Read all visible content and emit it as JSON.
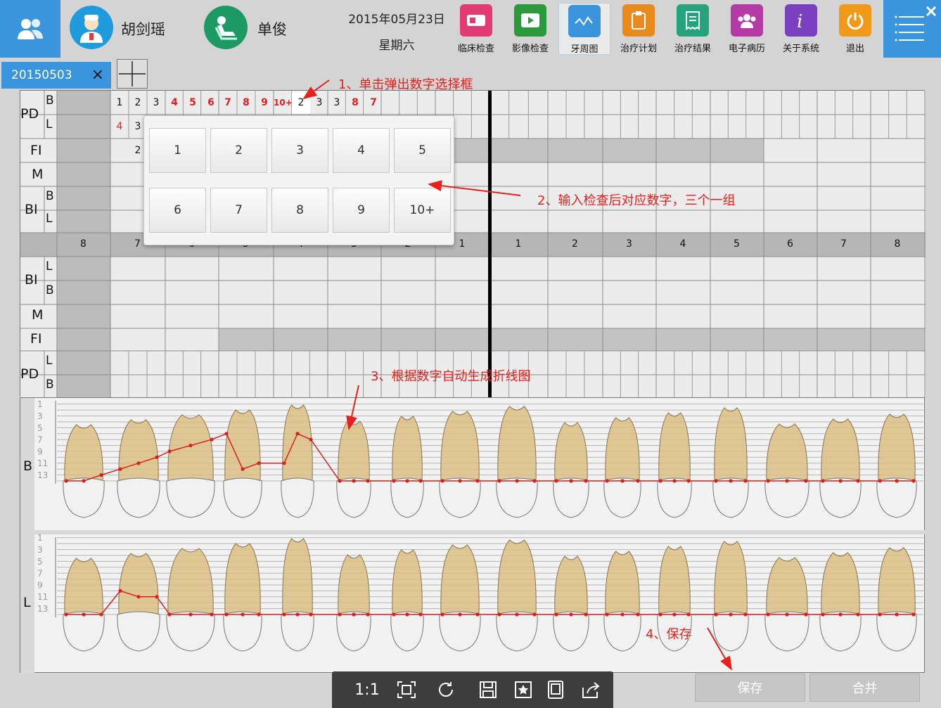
{
  "topbar": {
    "doctor_name": "胡剑瑶",
    "patient_name": "单俊",
    "date": "2015年05月23日",
    "weekday": "星期六",
    "buttons": [
      {
        "label": "临床检查",
        "color": "#e23a73",
        "icon": "id-card-icon"
      },
      {
        "label": "影像检查",
        "color": "#2a9a3c",
        "icon": "video-icon"
      },
      {
        "label": "牙周图",
        "color": "#3b95dc",
        "icon": "pulse-chart-icon"
      },
      {
        "label": "治疗计划",
        "color": "#e98a1f",
        "icon": "clipboard-icon"
      },
      {
        "label": "治疗结果",
        "color": "#26a37c",
        "icon": "receipt-icon"
      },
      {
        "label": "电子病历",
        "color": "#b43aa6",
        "icon": "group-icon"
      },
      {
        "label": "关于系统",
        "color": "#7a3ec0",
        "icon": "info-icon"
      },
      {
        "label": "退出",
        "color": "#f19a1a",
        "icon": "power-icon"
      }
    ]
  },
  "tab": {
    "label": "20150503",
    "close": "×"
  },
  "chart": {
    "row_labels_top": {
      "pd": "PD",
      "b": "B",
      "l": "L",
      "fi": "FI",
      "m": "M",
      "bi": "BI"
    },
    "row_labels_bottom": {
      "bi": "BI",
      "l": "L",
      "b": "B",
      "m": "M",
      "fi": "FI",
      "pd": "PD"
    },
    "pd_b_values": [
      "1",
      "2",
      "3",
      "4",
      "5",
      "6",
      "7",
      "8",
      "9",
      "10+",
      "2",
      "3",
      "3",
      "8",
      "7"
    ],
    "pd_b_red": [
      false,
      false,
      false,
      true,
      true,
      true,
      true,
      true,
      true,
      true,
      false,
      false,
      false,
      true,
      true
    ],
    "pd_l_values": [
      "4",
      "3"
    ],
    "fi_value": "2",
    "left_teeth": [
      "8",
      "7",
      "6",
      "5",
      "4",
      "3",
      "2",
      "1"
    ],
    "right_teeth": [
      "1",
      "2",
      "3",
      "4",
      "5",
      "6",
      "7",
      "8"
    ]
  },
  "popup": {
    "keys": [
      "1",
      "2",
      "3",
      "4",
      "5",
      "6",
      "7",
      "8",
      "9",
      "10+"
    ]
  },
  "graph": {
    "b_label": "B",
    "l_label": "L",
    "scale": [
      "13",
      "11",
      "9",
      "7",
      "5",
      "3",
      "1"
    ],
    "b_line": [
      0,
      0,
      1,
      2,
      3,
      4,
      5,
      6,
      7,
      8,
      2,
      3,
      3,
      8,
      7,
      0,
      0,
      0,
      0,
      0,
      0,
      0,
      0,
      0,
      0,
      0,
      0,
      0,
      0,
      0,
      0,
      0,
      0,
      0,
      0,
      0,
      0,
      0,
      0,
      0,
      0,
      0,
      0,
      0,
      0,
      0,
      0,
      0
    ],
    "l_line": [
      0,
      0,
      0,
      4,
      3,
      3,
      0,
      0,
      0,
      0,
      0,
      0,
      0,
      0,
      0,
      0,
      0,
      0,
      0,
      0,
      0,
      0,
      0,
      0,
      0,
      0,
      0,
      0,
      0,
      0,
      0,
      0,
      0,
      0,
      0,
      0,
      0,
      0,
      0,
      0,
      0,
      0,
      0,
      0,
      0,
      0,
      0,
      0
    ]
  },
  "annotations": {
    "a1": "1、单击弹出数字选择框",
    "a2": "2、输入检查后对应数字，三个一组",
    "a3": "3、根据数字自动生成折线图",
    "a4": "4、保存"
  },
  "bottom": {
    "zoom_label": "1:1",
    "save": "保存",
    "merge": "合并"
  },
  "colors": {
    "accent": "#3b95dc",
    "annotation": "#e8201c",
    "tooth_root": "#d8bd86",
    "line": "#d8201c"
  }
}
